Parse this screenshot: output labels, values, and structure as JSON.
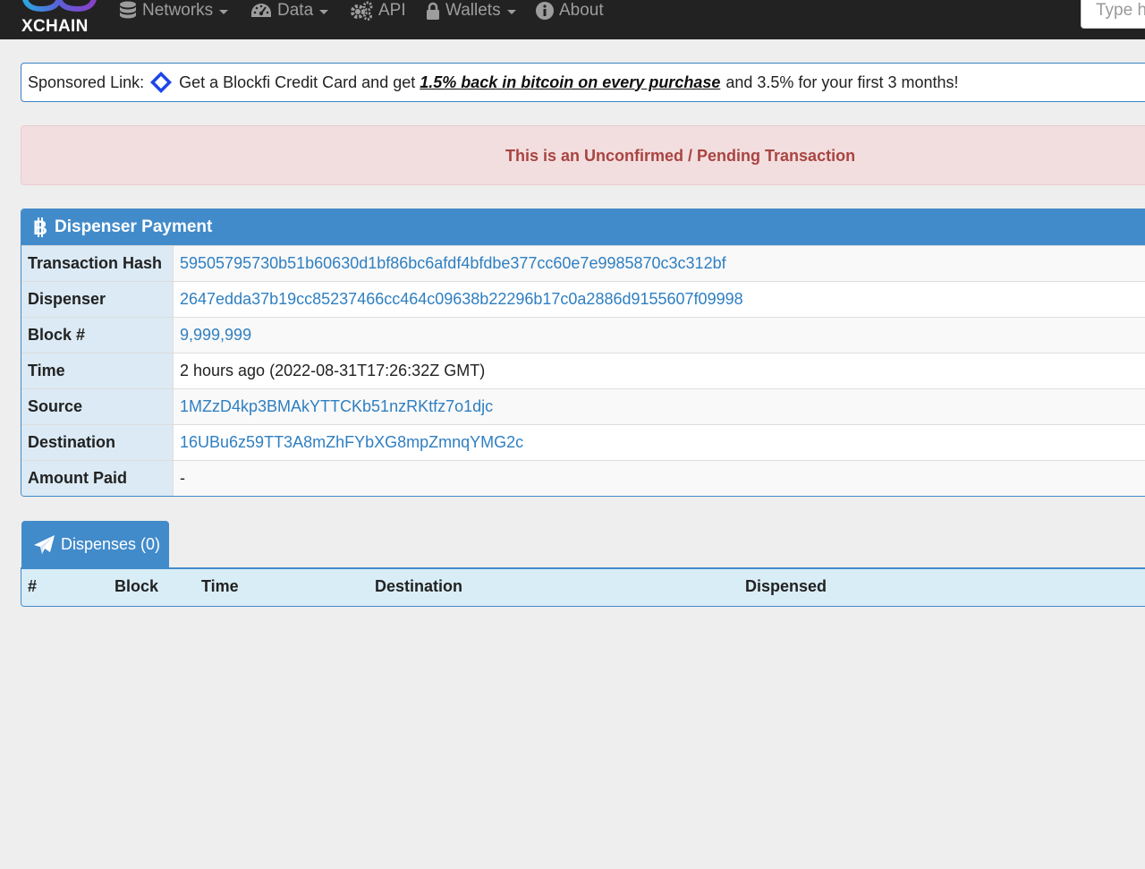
{
  "brand": {
    "name": "XCHAIN"
  },
  "nav": {
    "networks": "Networks",
    "data": "Data",
    "api": "API",
    "wallets": "Wallets",
    "about": "About",
    "search_placeholder": "Type here to search"
  },
  "sponsor": {
    "label": "Sponsored Link:",
    "text_before": "Get a Blockfi Credit Card and get",
    "link_text": "1.5% back in bitcoin on every purchase",
    "text_after": "and 3.5% for your first 3 months!"
  },
  "alert": {
    "message": "This is an Unconfirmed / Pending Transaction"
  },
  "panel": {
    "title": "Dispenser Payment",
    "rows": [
      {
        "label": "Transaction Hash",
        "value": "59505795730b51b60630d1bf86bc6afdf4bfdbe377cc60e7e9985870c3c312bf"
      },
      {
        "label": "Dispenser",
        "value": "2647edda37b19cc85237466cc464c09638b22296b17c0a2886d9155607f09998"
      },
      {
        "label": "Block #",
        "value": "9,999,999"
      },
      {
        "label": "Time",
        "value": "2 hours ago (2022-08-31T17:26:32Z GMT)"
      },
      {
        "label": "Source",
        "value": "1MZzD4kp3BMAkYTTCKb51nzRKtfz7o1djc"
      },
      {
        "label": "Destination",
        "value": "16UBu6z59TT3A8mZhFYbXG8mpZmnqYMG2c"
      },
      {
        "label": "Amount Paid",
        "value": "-"
      }
    ]
  },
  "dispenses": {
    "tab_label": "Dispenses (0)",
    "columns": [
      "#",
      "Block",
      "Time",
      "Destination",
      "Dispensed"
    ]
  },
  "colors": {
    "navbar": "#222222",
    "primary": "#428bca",
    "link": "#2f7fc1",
    "alert_bg": "#f2dede",
    "alert_text": "#a94442"
  }
}
